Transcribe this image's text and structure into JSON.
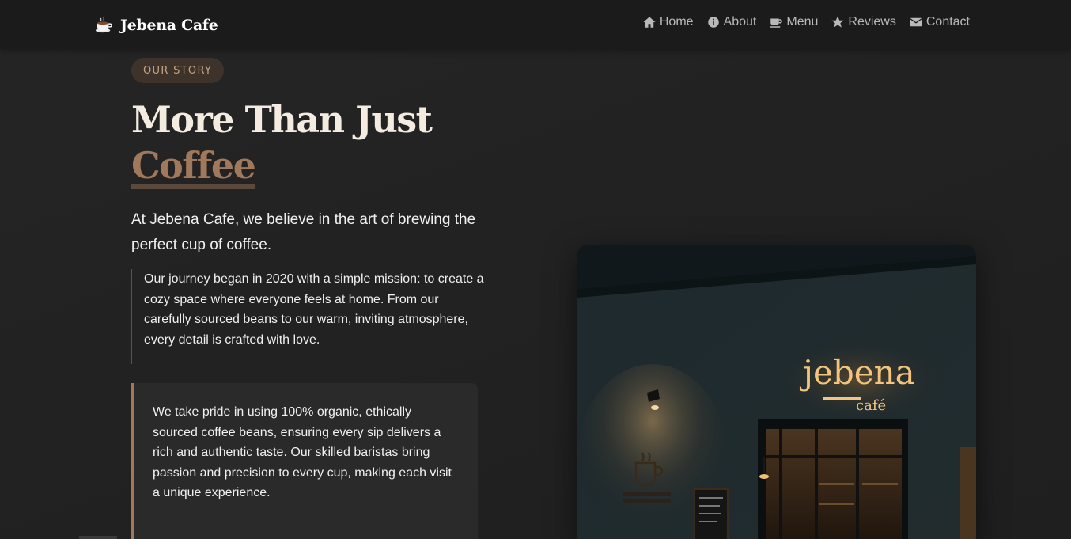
{
  "brand": {
    "name": "Jebena Cafe",
    "icon": "coffee-cup-icon"
  },
  "nav": [
    {
      "label": "Home",
      "icon": "home-icon"
    },
    {
      "label": "About",
      "icon": "info-icon"
    },
    {
      "label": "Menu",
      "icon": "coffee-icon"
    },
    {
      "label": "Reviews",
      "icon": "star-icon"
    },
    {
      "label": "Contact",
      "icon": "envelope-icon"
    }
  ],
  "hero": {
    "badge": "OUR STORY",
    "title_line1": "More Than Just",
    "title_accent": "Coffee",
    "lead": "At Jebena Cafe, we believe in the art of brewing the perfect cup of coffee.",
    "story": "Our journey began in 2020 with a simple mission: to create a cozy space where everyone feels at home. From our carefully sourced beans to our warm, inviting atmosphere, every detail is crafted with love.",
    "pride": "We take pride in using 100% organic, ethically sourced coffee beans, ensuring every sip delivers a rich and authentic taste. Our skilled baristas bring passion and precision to every cup, making each visit a unique experience."
  },
  "photo": {
    "sign_main": "jebena",
    "sign_sub": "café"
  },
  "colors": {
    "accent": "#a0785b",
    "background": "#232323",
    "navbar": "#1b1b1b",
    "badge_bg": "#3d332b",
    "badge_text": "#c9a27f"
  }
}
